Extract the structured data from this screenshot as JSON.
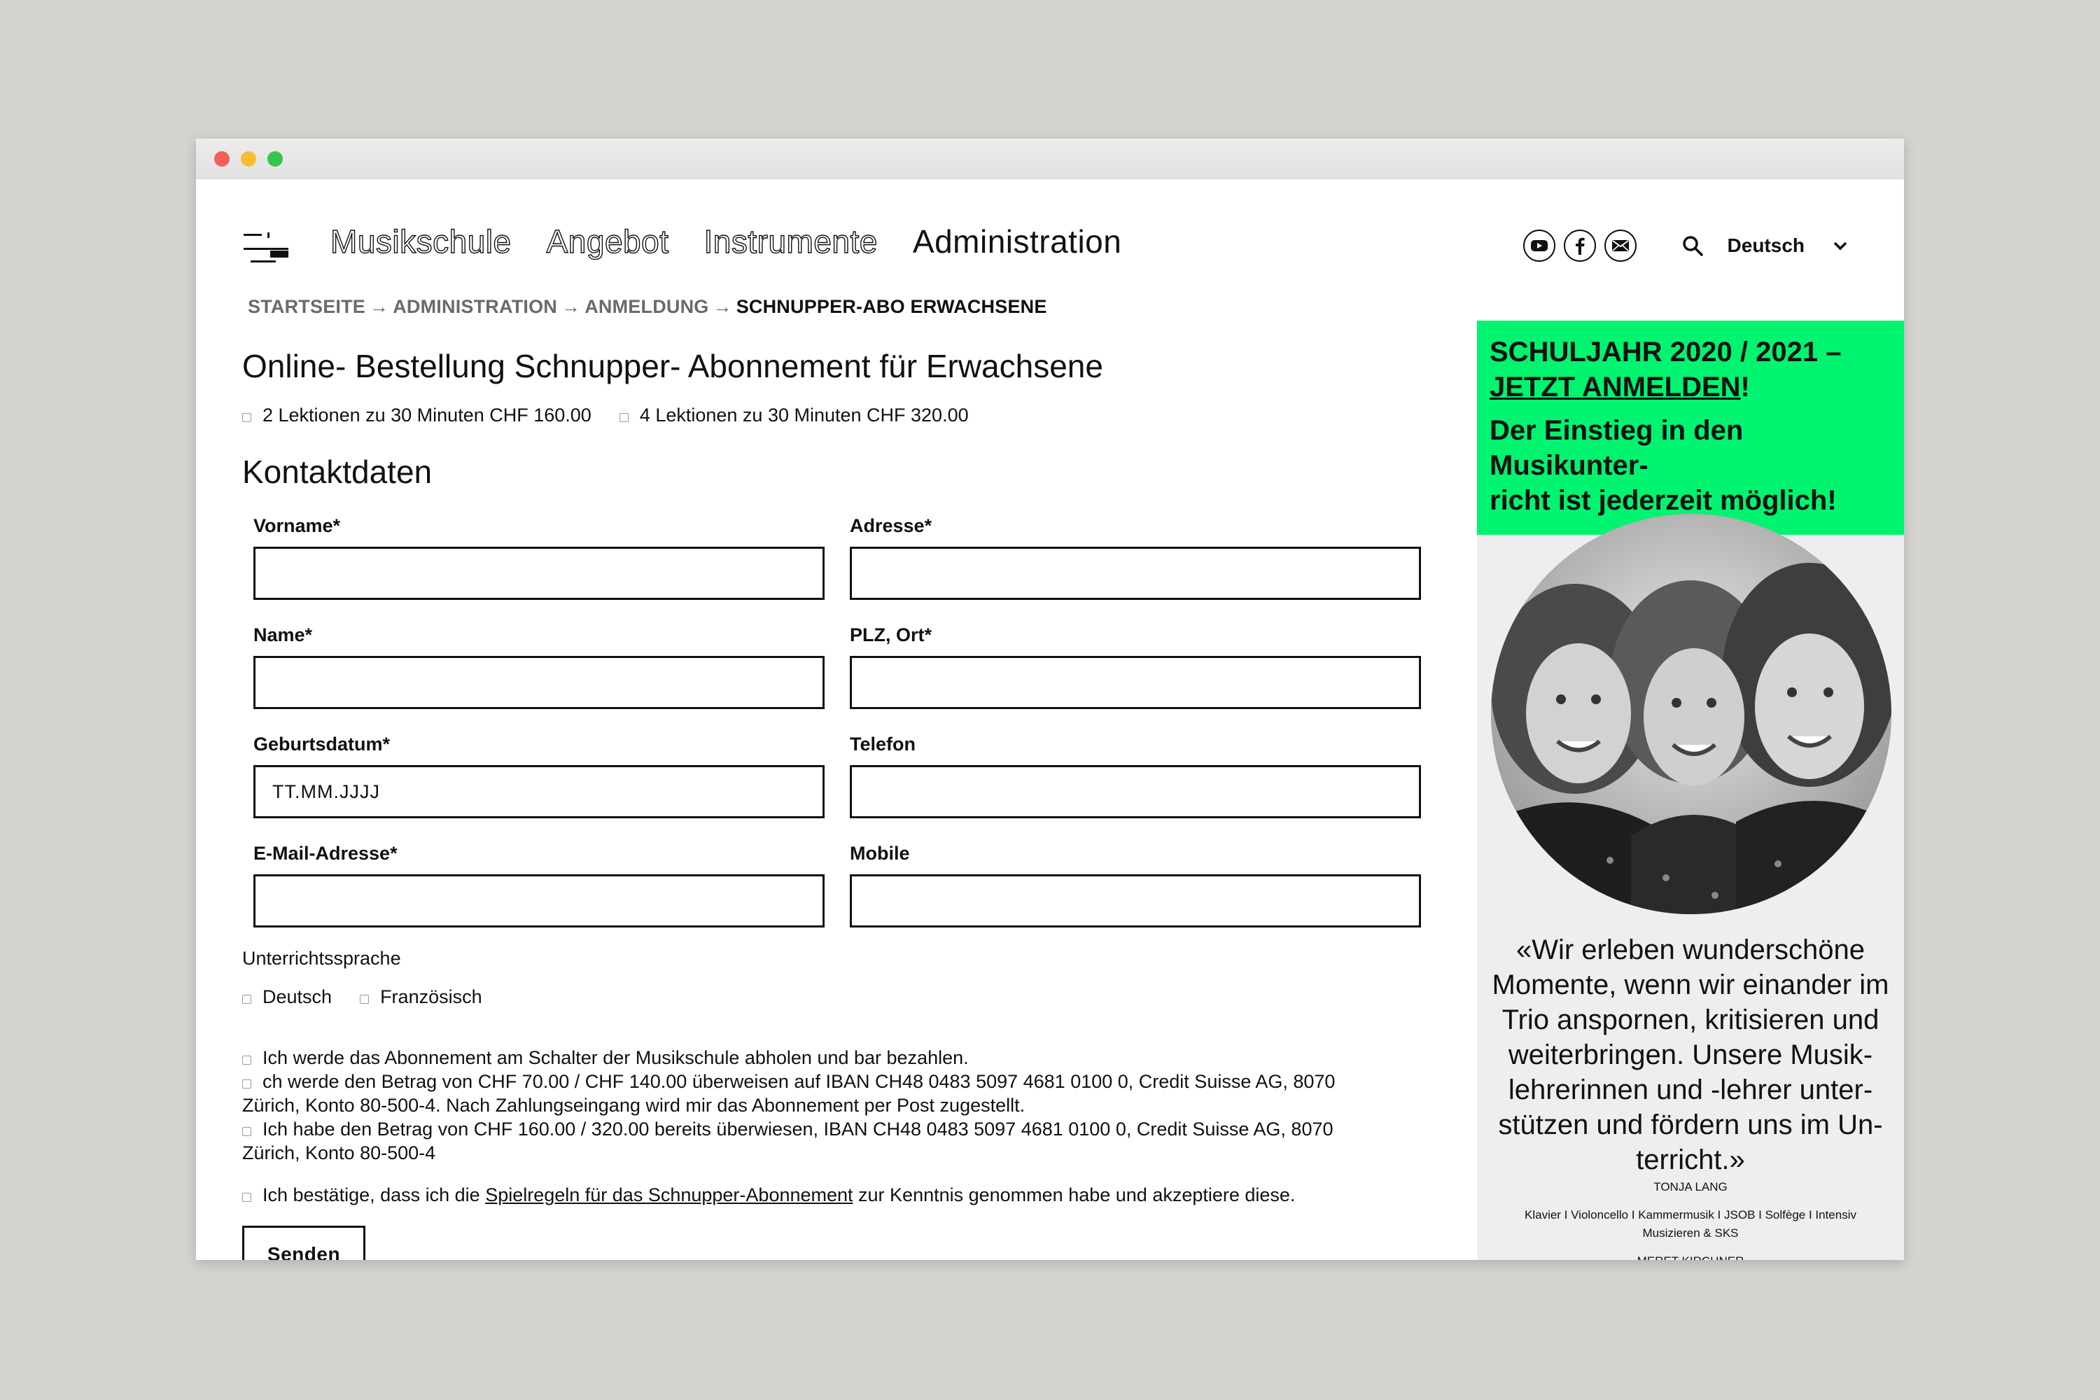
{
  "nav": {
    "items": [
      "Musikschule",
      "Angebot",
      "Instrumente",
      "Administration"
    ],
    "active_index": 3
  },
  "header": {
    "social": [
      "youtube-icon",
      "facebook-icon",
      "mail-icon"
    ],
    "language": "Deutsch"
  },
  "breadcrumb": {
    "items": [
      "STARTSEITE",
      "ADMINISTRATION",
      "ANMELDUNG",
      "SCHNUPPER-ABO ERWACHSENE"
    ],
    "separator": "→"
  },
  "page": {
    "title": "Online- Bestellung Schnupper- Abonnement für Erwachsene",
    "options": [
      "2 Lektionen zu 30 Minuten CHF 160.00",
      "4 Lektionen zu 30 Minuten CHF 320.00"
    ],
    "section": "Kontaktdaten"
  },
  "form": {
    "vorname": {
      "label": "Vorname*",
      "value": ""
    },
    "adresse": {
      "label": "Adresse*",
      "value": ""
    },
    "name": {
      "label": "Name*",
      "value": ""
    },
    "plz": {
      "label": "PLZ, Ort*",
      "value": ""
    },
    "geburtsdatum": {
      "label": "Geburtsdatum*",
      "value": "TT.MM.JJJJ"
    },
    "telefon": {
      "label": "Telefon",
      "value": ""
    },
    "email": {
      "label": "E-Mail-Adresse*",
      "value": ""
    },
    "mobile": {
      "label": "Mobile",
      "value": ""
    }
  },
  "lower": {
    "language_label": "Unterrichtssprache",
    "languages": [
      "Deutsch",
      "Französisch"
    ],
    "payment": [
      "Ich werde das Abonnement am Schalter der Musikschule abholen und bar bezahlen.",
      "ch werde den Betrag von CHF 70.00 / CHF 140.00 überweisen auf IBAN CH48 0483 5097 4681 0100 0, Credit Suisse AG, 8070",
      "Zürich, Konto 80-500-4. Nach Zahlungseingang wird mir das Abonnement per Post zugestellt.",
      "Ich habe den Betrag von CHF 160.00 / 320.00 bereits überwiesen, IBAN CH48 0483 5097 4681 0100 0, Credit Suisse AG, 8070",
      "Zürich, Konto 80-500-4"
    ],
    "confirm_pre": "Ich bestätige, dass ich die ",
    "confirm_link": "Spielregeln für das Schnupper-Abonnement",
    "confirm_post": " zur Kenntnis genommen habe und akzeptiere diese.",
    "submit": "Senden"
  },
  "sidebar": {
    "promo_line1": "SCHULJAHR 2020 / 2021 –",
    "promo_link": "JETZT ANMELDEN",
    "promo_excl": "!",
    "promo_line2": "Der Einstieg in den Musikunter-",
    "promo_line3": "richt ist jederzeit möglich!",
    "quote_lines": [
      "«Wir erleben wunderschöne",
      "Momente, wenn wir einander im",
      "Trio anspornen, kritisieren und",
      "weiterbringen. Unsere Musik-",
      "lehrerinnen und -lehrer unter-",
      "stützen und fördern uns im Un-",
      "terricht.»"
    ],
    "person1_name": "TONJA LANG",
    "person1_line1": "Klavier I Violoncello I Kammermusik I JSOB I  Solfège I Intensiv",
    "person1_line2": "Musizieren & SKS",
    "person2_name": "MERET KIRCHNER"
  },
  "colors": {
    "promo": "#00f46f",
    "sidebar_bg": "#eeeeee",
    "page_bg": "#d4d3cf"
  }
}
